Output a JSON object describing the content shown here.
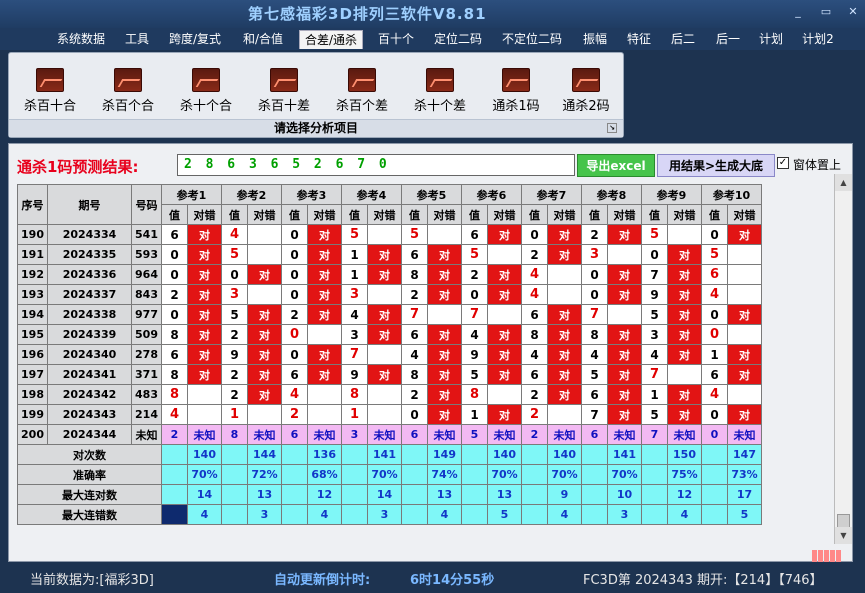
{
  "window": {
    "title": "第七感福彩3D排列三软件V8.81",
    "min": "_",
    "max": "▭",
    "close": "✕"
  },
  "menu": [
    "系统数据",
    "工具",
    "跨度/复式",
    "和/合值",
    "合差/通杀",
    "百十个",
    "定位二码",
    "不定位二码",
    "振幅",
    "特征",
    "后二",
    "后一",
    "计划",
    "计划2"
  ],
  "ribbon": {
    "buttons": [
      "杀百十合",
      "杀百个合",
      "杀十个合",
      "杀百十差",
      "杀百个差",
      "杀十个差",
      "通杀1码",
      "通杀2码"
    ],
    "caption": "请选择分析项目"
  },
  "result": {
    "label": "通杀1码预测结果:",
    "value": "2 8 6 3 6 5 2 6 7 0",
    "export_btn": "导出excel",
    "gen_btn": "用结果>生成大底",
    "topmost_label": "窗体置上"
  },
  "table": {
    "h_seq": "序号",
    "h_period": "期号",
    "h_num": "号码",
    "refs": [
      "参考1",
      "参考2",
      "参考3",
      "参考4",
      "参考5",
      "参考6",
      "参考7",
      "参考8",
      "参考9",
      "参考10"
    ],
    "sub_val": "值",
    "sub_ok": "对错",
    "mark": "对",
    "rows": [
      {
        "seq": "190",
        "period": "2024334",
        "num": "541",
        "vals": [
          "6",
          "4",
          "0",
          "5",
          "5",
          "6",
          "0",
          "2",
          "5",
          "0"
        ],
        "hits": [
          1,
          0,
          1,
          0,
          0,
          1,
          1,
          1,
          0,
          1
        ]
      },
      {
        "seq": "191",
        "period": "2024335",
        "num": "593",
        "vals": [
          "0",
          "5",
          "0",
          "1",
          "6",
          "5",
          "2",
          "3",
          "0",
          "5"
        ],
        "hits": [
          1,
          0,
          1,
          1,
          1,
          0,
          1,
          0,
          1,
          0
        ]
      },
      {
        "seq": "192",
        "period": "2024336",
        "num": "964",
        "vals": [
          "0",
          "0",
          "0",
          "1",
          "8",
          "2",
          "4",
          "0",
          "7",
          "6"
        ],
        "hits": [
          1,
          1,
          1,
          1,
          1,
          1,
          0,
          1,
          1,
          0
        ]
      },
      {
        "seq": "193",
        "period": "2024337",
        "num": "843",
        "vals": [
          "2",
          "3",
          "0",
          "3",
          "2",
          "0",
          "4",
          "0",
          "9",
          "4"
        ],
        "hits": [
          1,
          0,
          1,
          0,
          1,
          1,
          0,
          1,
          1,
          0
        ]
      },
      {
        "seq": "194",
        "period": "2024338",
        "num": "977",
        "vals": [
          "0",
          "5",
          "2",
          "4",
          "7",
          "7",
          "6",
          "7",
          "5",
          "0"
        ],
        "hits": [
          1,
          1,
          1,
          1,
          0,
          0,
          1,
          0,
          1,
          1
        ]
      },
      {
        "seq": "195",
        "period": "2024339",
        "num": "509",
        "vals": [
          "8",
          "2",
          "0",
          "3",
          "6",
          "4",
          "8",
          "8",
          "3",
          "0"
        ],
        "hits": [
          1,
          1,
          0,
          1,
          1,
          1,
          1,
          1,
          1,
          0
        ]
      },
      {
        "seq": "196",
        "period": "2024340",
        "num": "278",
        "vals": [
          "6",
          "9",
          "0",
          "7",
          "4",
          "9",
          "4",
          "4",
          "4",
          "1"
        ],
        "hits": [
          1,
          1,
          1,
          0,
          1,
          1,
          1,
          1,
          1,
          1
        ]
      },
      {
        "seq": "197",
        "period": "2024341",
        "num": "371",
        "vals": [
          "8",
          "2",
          "6",
          "9",
          "8",
          "5",
          "6",
          "5",
          "7",
          "6"
        ],
        "hits": [
          1,
          1,
          1,
          1,
          1,
          1,
          1,
          1,
          0,
          1
        ]
      },
      {
        "seq": "198",
        "period": "2024342",
        "num": "483",
        "vals": [
          "8",
          "2",
          "4",
          "8",
          "2",
          "8",
          "2",
          "6",
          "1",
          "4"
        ],
        "hits": [
          0,
          1,
          0,
          0,
          1,
          0,
          1,
          1,
          1,
          0
        ]
      },
      {
        "seq": "199",
        "period": "2024343",
        "num": "214",
        "vals": [
          "4",
          "1",
          "2",
          "1",
          "0",
          "1",
          "2",
          "7",
          "5",
          "0"
        ],
        "hits": [
          0,
          0,
          0,
          0,
          1,
          1,
          0,
          1,
          1,
          1
        ]
      }
    ],
    "pending": {
      "seq": "200",
      "period": "2024344",
      "num": "未知",
      "vals": [
        "2",
        "8",
        "6",
        "3",
        "6",
        "5",
        "2",
        "6",
        "7",
        "0"
      ],
      "unk": "未知"
    },
    "stat_labels": [
      "对次数",
      "准确率",
      "最大连对数",
      "最大连错数"
    ],
    "stat_vals": [
      [
        "140",
        "144",
        "136",
        "141",
        "149",
        "140",
        "140",
        "141",
        "150",
        "147"
      ],
      [
        "70%",
        "72%",
        "68%",
        "70%",
        "74%",
        "70%",
        "70%",
        "70%",
        "75%",
        "73%"
      ],
      [
        "14",
        "13",
        "12",
        "14",
        "13",
        "13",
        "9",
        "10",
        "12",
        "17"
      ],
      [
        "4",
        "3",
        "4",
        "3",
        "4",
        "5",
        "4",
        "3",
        "4",
        "5"
      ]
    ]
  },
  "status": {
    "current": "当前数据为:[福彩3D]",
    "countdown_label": "自动更新倒计时:",
    "countdown": "6时14分55秒",
    "draw": "FC3D第 2024343 期开:【214】【746】"
  }
}
